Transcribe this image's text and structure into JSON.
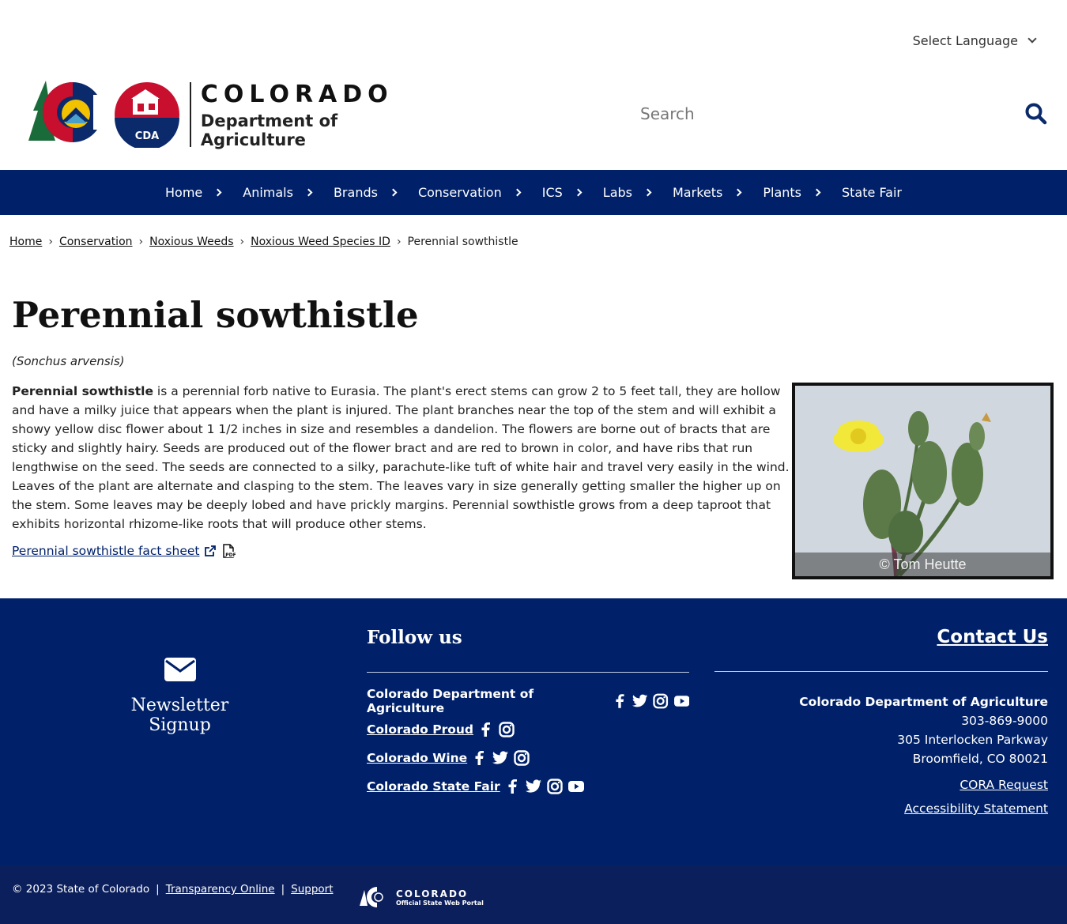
{
  "language": {
    "label": "Select Language"
  },
  "header": {
    "logo_badge": "CDA",
    "logo_title": "COLORADO",
    "logo_subtitle": "Department of Agriculture",
    "search_placeholder": "Search"
  },
  "nav": {
    "items": [
      {
        "label": "Home"
      },
      {
        "label": "Animals"
      },
      {
        "label": "Brands"
      },
      {
        "label": "Conservation"
      },
      {
        "label": "ICS"
      },
      {
        "label": "Labs"
      },
      {
        "label": "Markets"
      },
      {
        "label": "Plants"
      },
      {
        "label": "State Fair"
      }
    ]
  },
  "breadcrumb": {
    "items": [
      "Home",
      "Conservation",
      "Noxious Weeds",
      "Noxious Weed Species ID"
    ],
    "current": "Perennial sowthistle"
  },
  "page": {
    "title": "Perennial sowthistle",
    "scientific_name": "(Sonchus arvensis)",
    "lead_bold": "Perennial sowthistle",
    "description": " is a perennial forb native to Eurasia. The plant's erect stems can grow 2 to 5 feet tall, they are hollow and have a milky juice that appears when the plant is injured. The plant branches near the top of the stem and will exhibit a showy yellow disc flower about 1 1/2 inches in size and resembles a dandelion. The flowers are borne out of bracts that are sticky and slightly hairy. Seeds are produced out of the flower bract and are red to brown in color, and have ribs that run lengthwise on the seed. The seeds are connected to a silky, parachute-like tuft of white hair and travel very easily in the wind. Leaves of the plant are alternate and clasping to the stem. The leaves vary in size generally getting smaller the higher up on the stem. Some leaves may be deeply lobed and have prickly margins. Perennial sowthistle grows from a deep taproot that exhibits horizontal rhizome-like roots that will produce other stems.",
    "fact_sheet_link": "Perennial sowthistle fact sheet",
    "photo_credit": "© Tom Heutte"
  },
  "footer": {
    "newsletter": "Newsletter Signup",
    "follow_title": "Follow us",
    "social": [
      {
        "name": "Colorado Department of Agriculture",
        "icons": [
          "facebook",
          "twitter",
          "instagram",
          "youtube"
        ]
      },
      {
        "name": "Colorado Proud",
        "icons": [
          "facebook",
          "instagram"
        ]
      },
      {
        "name": "Colorado Wine",
        "icons": [
          "facebook",
          "twitter",
          "instagram"
        ]
      },
      {
        "name": "Colorado State Fair",
        "icons": [
          "facebook",
          "twitter",
          "instagram",
          "youtube"
        ]
      }
    ],
    "contact_title": "Contact Us",
    "org": "Colorado Department of Agriculture",
    "phone": "303-869-9000",
    "address1": "305 Interlocken Parkway",
    "address2": "Broomfield, CO 80021",
    "cora": "CORA Request",
    "accessibility": "Accessibility Statement"
  },
  "bottom": {
    "copyright": "© 2023 State of Colorado",
    "sep": "|",
    "transparency": "Transparency Online",
    "support": "Support",
    "portal_title": "COLORADO",
    "portal_subtitle": "Official State Web Portal"
  },
  "colors": {
    "nav_bg": "#002169",
    "footer_bg": "#002169",
    "bottom_bg": "#0b1f5c",
    "link": "#002169"
  }
}
